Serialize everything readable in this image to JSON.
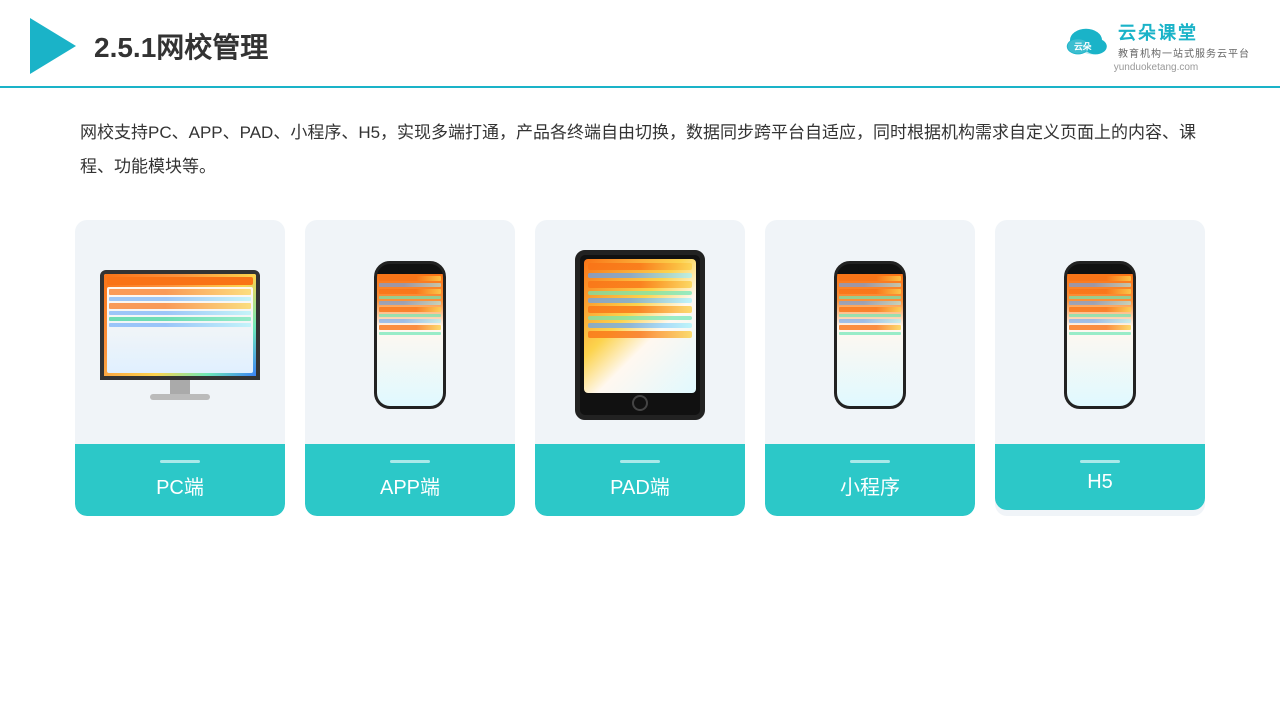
{
  "header": {
    "title": "2.5.1网校管理",
    "brand_name": "云朵课堂",
    "brand_url": "yunduoketang.com",
    "brand_sub": "教育机构一站\n式服务云平台"
  },
  "description": "网校支持PC、APP、PAD、小程序、H5，实现多端打通，产品各终端自由切换，数据同步跨平台自适应，同时根据机构需求自定义页面上的内容、课程、功能模块等。",
  "cards": [
    {
      "id": "pc",
      "label": "PC端"
    },
    {
      "id": "app",
      "label": "APP端"
    },
    {
      "id": "pad",
      "label": "PAD端"
    },
    {
      "id": "mini",
      "label": "小程序"
    },
    {
      "id": "h5",
      "label": "H5"
    }
  ]
}
